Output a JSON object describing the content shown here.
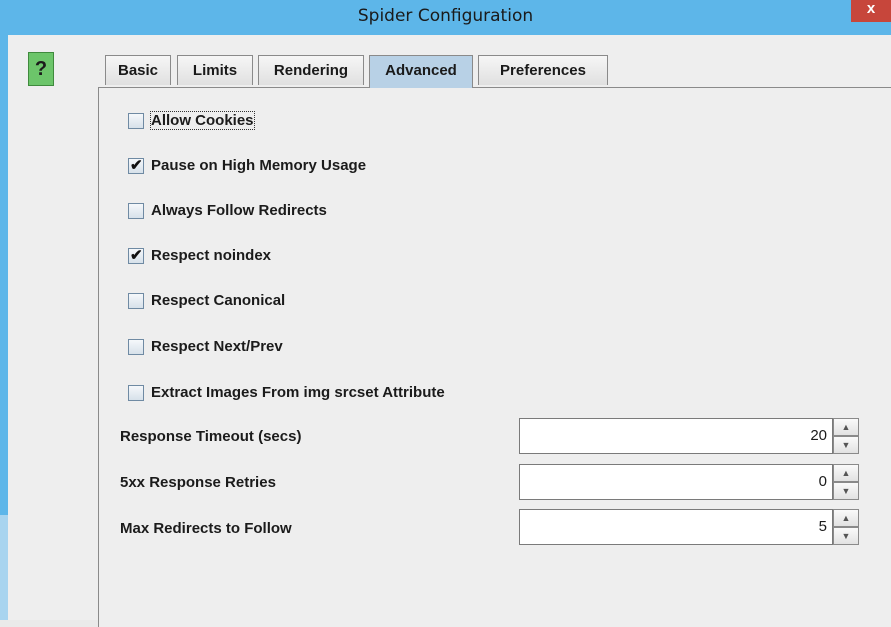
{
  "window": {
    "title": "Spider Configuration",
    "close_glyph": "x"
  },
  "help": {
    "glyph": "?",
    "icon": "help-icon"
  },
  "tabs": [
    {
      "label": "Basic",
      "active": false
    },
    {
      "label": "Limits",
      "active": false
    },
    {
      "label": "Rendering",
      "active": false
    },
    {
      "label": "Advanced",
      "active": true
    },
    {
      "label": "Preferences",
      "active": false
    }
  ],
  "checkboxes": [
    {
      "label": "Allow Cookies",
      "checked": false
    },
    {
      "label": "Pause on High Memory Usage",
      "checked": true
    },
    {
      "label": "Always Follow Redirects",
      "checked": false
    },
    {
      "label": "Respect noindex",
      "checked": true
    },
    {
      "label": "Respect Canonical",
      "checked": false
    },
    {
      "label": "Respect Next/Prev",
      "checked": false
    },
    {
      "label": "Extract Images From img srcset Attribute",
      "checked": false
    }
  ],
  "check_glyph": "✔",
  "spinners": [
    {
      "label": "Response Timeout (secs)",
      "value": "20"
    },
    {
      "label": "5xx Response Retries",
      "value": "0"
    },
    {
      "label": "Max Redirects to Follow",
      "value": "5"
    }
  ],
  "spinner_glyphs": {
    "up": "▲",
    "down": "▼"
  },
  "colors": {
    "titlebar": "#5db6e9",
    "close": "#c7463b",
    "active_tab": "#b8d1e6",
    "help": "#6cc56a"
  }
}
